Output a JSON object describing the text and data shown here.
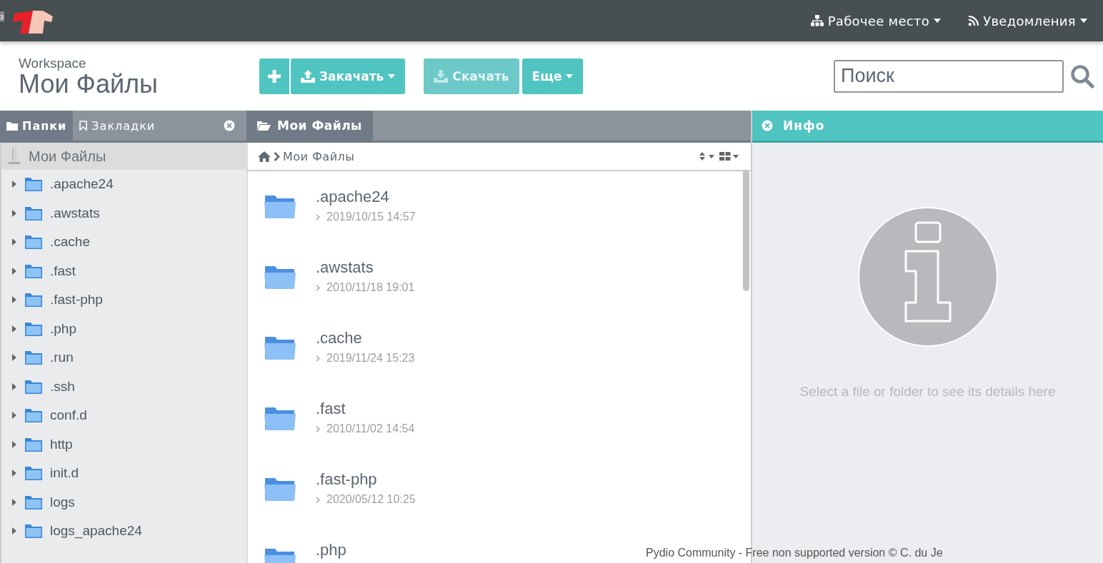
{
  "topbar": {
    "edge_fragment": "з",
    "menus": [
      {
        "label": "Рабочее место",
        "kind": "workspace"
      },
      {
        "label": "Уведомления",
        "kind": "feed"
      }
    ]
  },
  "header": {
    "subtitle": "Workspace",
    "title": "Мои Файлы"
  },
  "toolbar": {
    "buttons": [
      {
        "kind": "add",
        "disabled": false,
        "dropdown": false
      },
      {
        "kind": "upload",
        "label": "Закачать",
        "disabled": false,
        "dropdown": true
      },
      {
        "kind": "download",
        "label": "Скачать",
        "disabled": true,
        "dropdown": false
      },
      {
        "kind": "more",
        "label": "Еще",
        "disabled": false,
        "dropdown": true
      }
    ]
  },
  "search": {
    "placeholder": "Поиск"
  },
  "left_tabs": [
    {
      "label": "Папки",
      "kind": "folder",
      "selected": true
    },
    {
      "label": "Закладки",
      "kind": "bookmark",
      "selected": false
    }
  ],
  "tree": {
    "root": {
      "label": "Мои Файлы",
      "selected": true
    },
    "items": [
      {
        "label": ".apache24",
        "expanded": false
      },
      {
        "label": ".awstats",
        "expanded": false
      },
      {
        "label": ".cache",
        "expanded": false
      },
      {
        "label": ".fast",
        "expanded": false
      },
      {
        "label": ".fast-php",
        "expanded": false
      },
      {
        "label": ".php",
        "expanded": false
      },
      {
        "label": ".run",
        "expanded": false
      },
      {
        "label": ".ssh",
        "expanded": false
      },
      {
        "label": "conf.d",
        "expanded": false
      },
      {
        "label": "http",
        "expanded": false
      },
      {
        "label": "init.d",
        "expanded": false
      },
      {
        "label": "logs",
        "expanded": false
      },
      {
        "label": "logs_apache24",
        "expanded": false
      }
    ]
  },
  "main_tab": {
    "label": "Мои Файлы"
  },
  "breadcrumb": [
    "Мои Файлы"
  ],
  "files": [
    {
      "name": ".apache24",
      "date": "2019/10/15 14:57"
    },
    {
      "name": ".awstats",
      "date": "2010/11/18 19:01"
    },
    {
      "name": ".cache",
      "date": "2019/11/24 15:23"
    },
    {
      "name": ".fast",
      "date": "2010/11/02 14:54"
    },
    {
      "name": ".fast-php",
      "date": "2020/05/12 10:25"
    },
    {
      "name": ".php"
    }
  ],
  "info_panel": {
    "title": "Инфо",
    "message": "Select a file or folder to see its details here"
  },
  "footer": "Pydio Community - Free non supported version © C. du Je"
}
